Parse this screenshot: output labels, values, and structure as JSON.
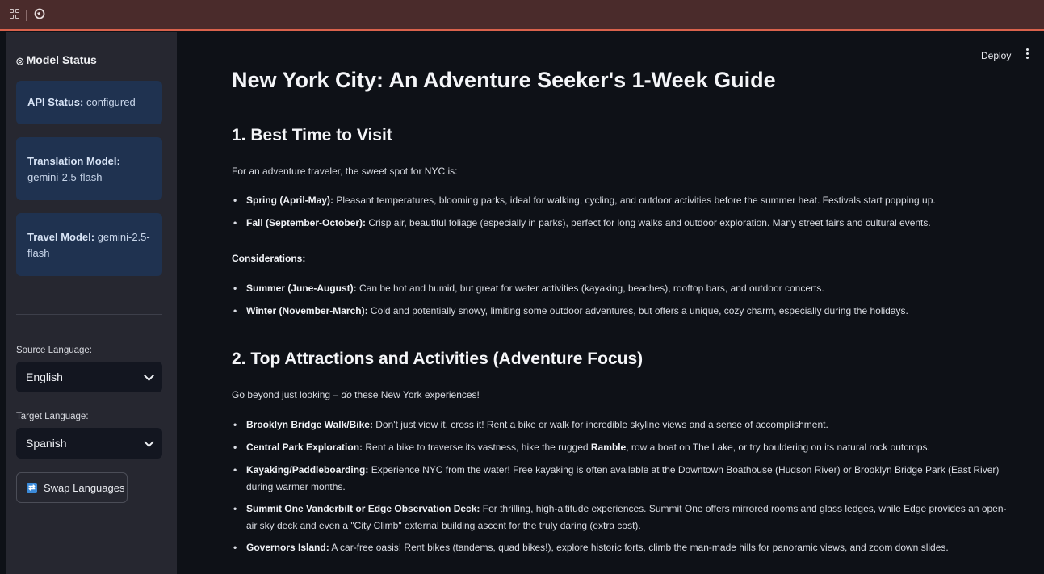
{
  "browser": {
    "icons": [
      "apps-grid-icon",
      "globe-icon"
    ]
  },
  "sidebar": {
    "title": "Model Status",
    "cards": [
      {
        "label": "API Status:",
        "value": "configured"
      },
      {
        "label": "Translation Model:",
        "value": "gemini-2.5-flash"
      },
      {
        "label": "Travel Model:",
        "value": "gemini-2.5-flash"
      }
    ],
    "source_label": "Source Language:",
    "source_value": "English",
    "target_label": "Target Language:",
    "target_value": "Spanish",
    "swap_button": "Swap Languages"
  },
  "toolbar": {
    "deploy": "Deploy"
  },
  "article": {
    "title": "New York City: An Adventure Seeker's 1-Week Guide",
    "s1": {
      "heading": "1. Best Time to Visit",
      "intro": "For an adventure traveler, the sweet spot for NYC is:",
      "items": [
        {
          "b": "Spring (April-May):",
          "t": "Pleasant temperatures, blooming parks, ideal for walking, cycling, and outdoor activities before the summer heat. Festivals start popping up."
        },
        {
          "b": "Fall (September-October):",
          "t": "Crisp air, beautiful foliage (especially in parks), perfect for long walks and outdoor exploration. Many street fairs and cultural events."
        }
      ],
      "considerations": "Considerations:",
      "items2": [
        {
          "b": "Summer (June-August):",
          "t": "Can be hot and humid, but great for water activities (kayaking, beaches), rooftop bars, and outdoor concerts."
        },
        {
          "b": "Winter (November-March):",
          "t": "Cold and potentially snowy, limiting some outdoor adventures, but offers a unique, cozy charm, especially during the holidays."
        }
      ]
    },
    "s2": {
      "heading": "2. Top Attractions and Activities (Adventure Focus)",
      "intro_pre": "Go beyond just looking – ",
      "intro_em": "do",
      "intro_post": " these New York experiences!",
      "items": [
        {
          "b": "Brooklyn Bridge Walk/Bike:",
          "t": "Don't just view it, cross it! Rent a bike or walk for incredible skyline views and a sense of accomplishment."
        },
        {
          "b": "Central Park Exploration:",
          "t1": "Rent a bike to traverse its vastness, hike the rugged ",
          "tb": "Ramble",
          "t2": ", row a boat on The Lake, or try bouldering on its natural rock outcrops."
        },
        {
          "b": "Kayaking/Paddleboarding:",
          "t": "Experience NYC from the water! Free kayaking is often available at the Downtown Boathouse (Hudson River) or Brooklyn Bridge Park (East River) during warmer months."
        },
        {
          "b": "Summit One Vanderbilt or Edge Observation Deck:",
          "t": "For thrilling, high-altitude experiences. Summit One offers mirrored rooms and glass ledges, while Edge provides an open-air sky deck and even a \"City Climb\" external building ascent for the truly daring (extra cost)."
        },
        {
          "b": "Governors Island:",
          "t": "A car-free oasis! Rent bikes (tandems, quad bikes!), explore historic forts, climb the man-made hills for panoramic views, and zoom down slides."
        }
      ]
    }
  }
}
